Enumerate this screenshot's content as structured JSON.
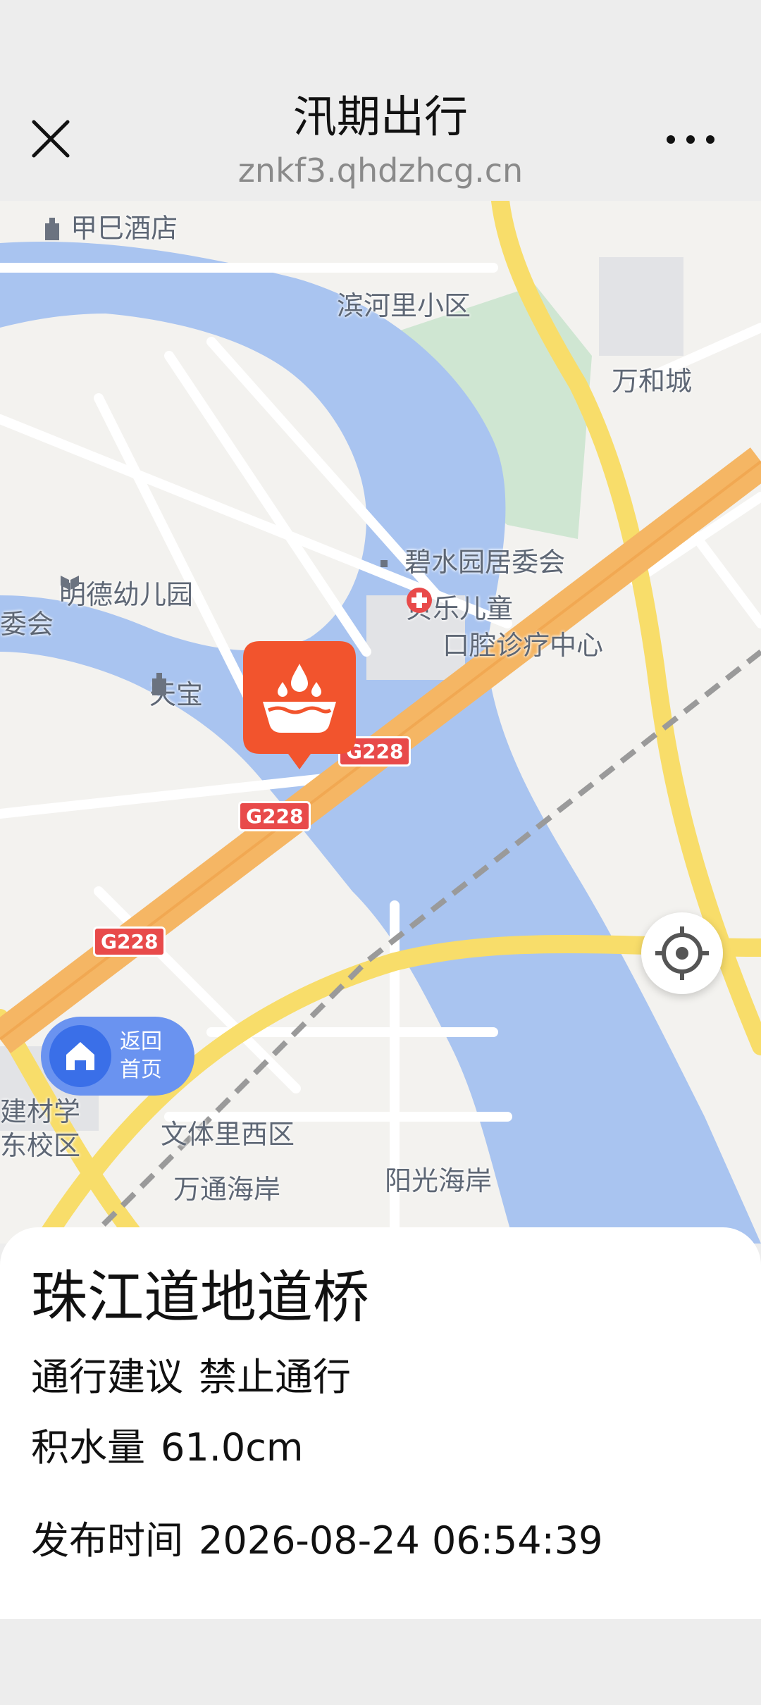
{
  "header": {
    "title": "汛期出行",
    "domain": "znkf3.qhdzhcg.cn"
  },
  "map": {
    "labels": {
      "jiasi_hotel": "甲巳酒店",
      "binheli": "滨河里小区",
      "wanhe": "万和城",
      "bishuiyuan": "碧水园居委会",
      "mingde": "明德幼儿园",
      "weihui": "委会",
      "beile_1": "贝乐儿童",
      "beile_2": "口腔诊疗中心",
      "tianbao": "天宝",
      "jiancai_1": "建材学",
      "jiancai_2": "东校区",
      "wentili": "文体里西区",
      "wantong": "万通海岸",
      "yangguang": "阳光海岸"
    },
    "road_shields": [
      "G228",
      "G228",
      "G228"
    ],
    "home_button": {
      "line1": "返回",
      "line2": "首页"
    }
  },
  "card": {
    "title": "珠江道地道桥",
    "advice_label": "通行建议",
    "advice_value": "禁止通行",
    "water_label": "积水量",
    "water_value": "61.0cm",
    "time_label": "发布时间",
    "time_value": "2026-08-24 06:54:39"
  },
  "colors": {
    "marker": "#f2542d",
    "home_button": "#6a93f0",
    "river": "#a9c4f0",
    "highway": "#f5b664",
    "main_road": "#f8dd6a"
  }
}
